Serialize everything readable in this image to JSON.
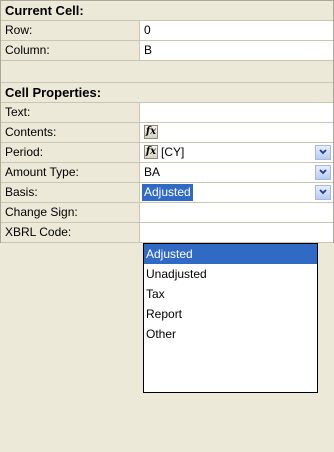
{
  "current_cell": {
    "header": "Current Cell:",
    "row_label": "Row:",
    "row_value": "0",
    "column_label": "Column:",
    "column_value": "B"
  },
  "cell_properties": {
    "header": "Cell Properties:",
    "text_label": "Text:",
    "text_value": "",
    "contents_label": "Contents:",
    "period_label": "Period:",
    "period_value": "[CY]",
    "amount_type_label": "Amount Type:",
    "amount_type_value": "BA",
    "basis_label": "Basis:",
    "basis_value": "Adjusted",
    "change_sign_label": "Change Sign:",
    "xbrl_code_label": "XBRL Code:"
  },
  "basis_dropdown": {
    "options": [
      "Adjusted",
      "Unadjusted",
      "Tax",
      "Report",
      "Other"
    ],
    "selected_index": 0
  },
  "icons": {
    "formula": "fx-icon",
    "dropdown": "chevron-down-icon"
  },
  "colors": {
    "selection": "#316AC5",
    "panel": "#ECE9D8",
    "value_bg": "#FFFFFF"
  }
}
